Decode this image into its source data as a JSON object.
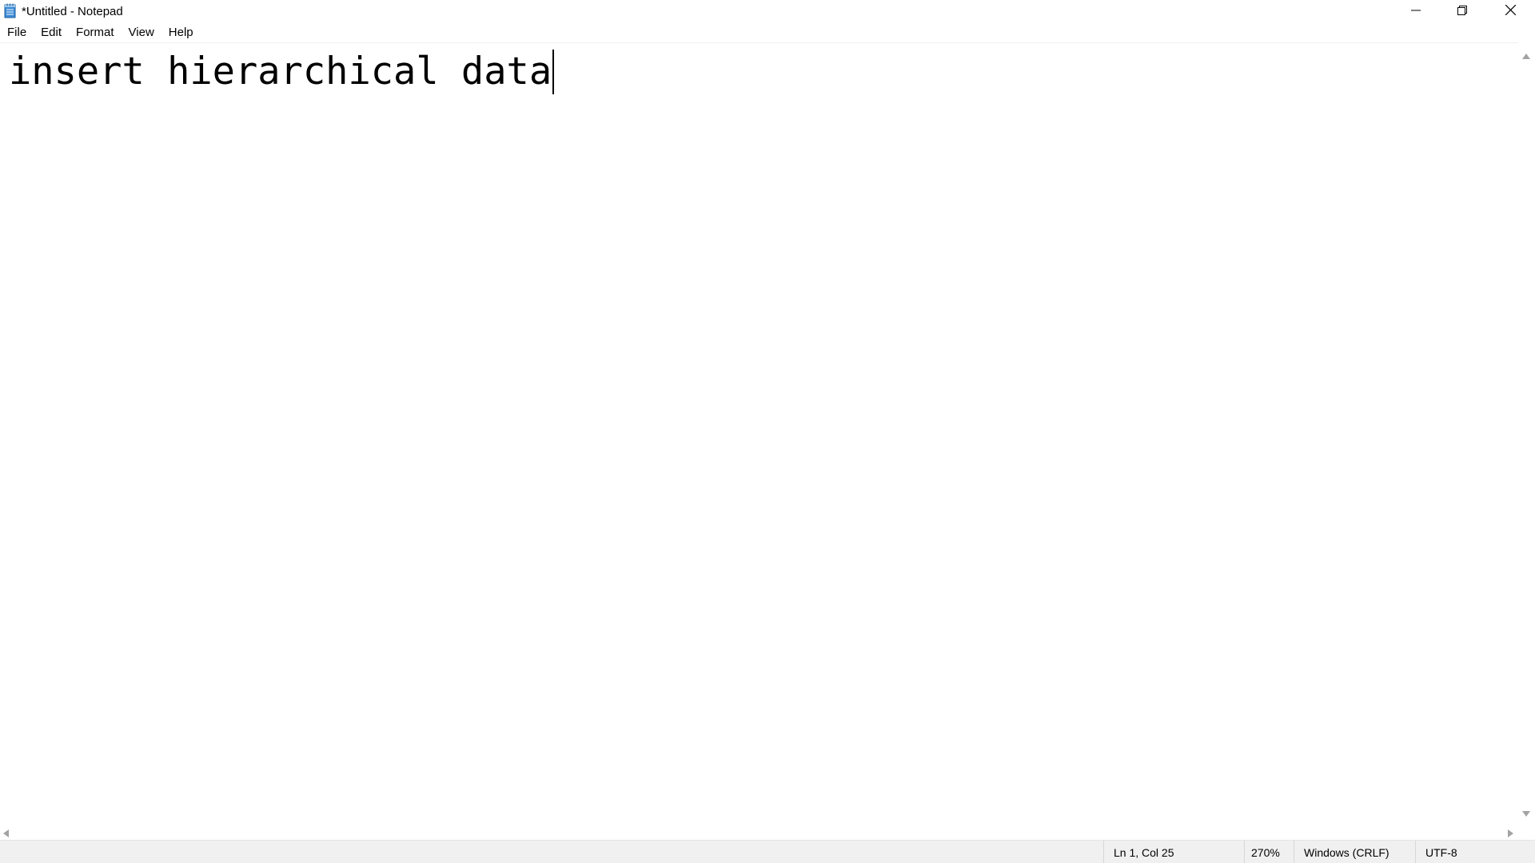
{
  "window": {
    "title": "*Untitled - Notepad",
    "icon": "notepad-icon",
    "controls": {
      "minimize_icon": "minimize-icon",
      "maximize_icon": "restore-icon",
      "close_icon": "close-icon"
    }
  },
  "menu": {
    "items": [
      {
        "label": "File"
      },
      {
        "label": "Edit"
      },
      {
        "label": "Format"
      },
      {
        "label": "View"
      },
      {
        "label": "Help"
      }
    ]
  },
  "editor": {
    "content": "insert hierarchical data"
  },
  "statusbar": {
    "position": "Ln 1, Col 25",
    "zoom": "270%",
    "line_ending": "Windows (CRLF)",
    "encoding": "UTF-8"
  },
  "colors": {
    "background": "#ffffff",
    "statusbar_bg": "#f0f0f0",
    "icon_blue": "#3c8bd6"
  }
}
